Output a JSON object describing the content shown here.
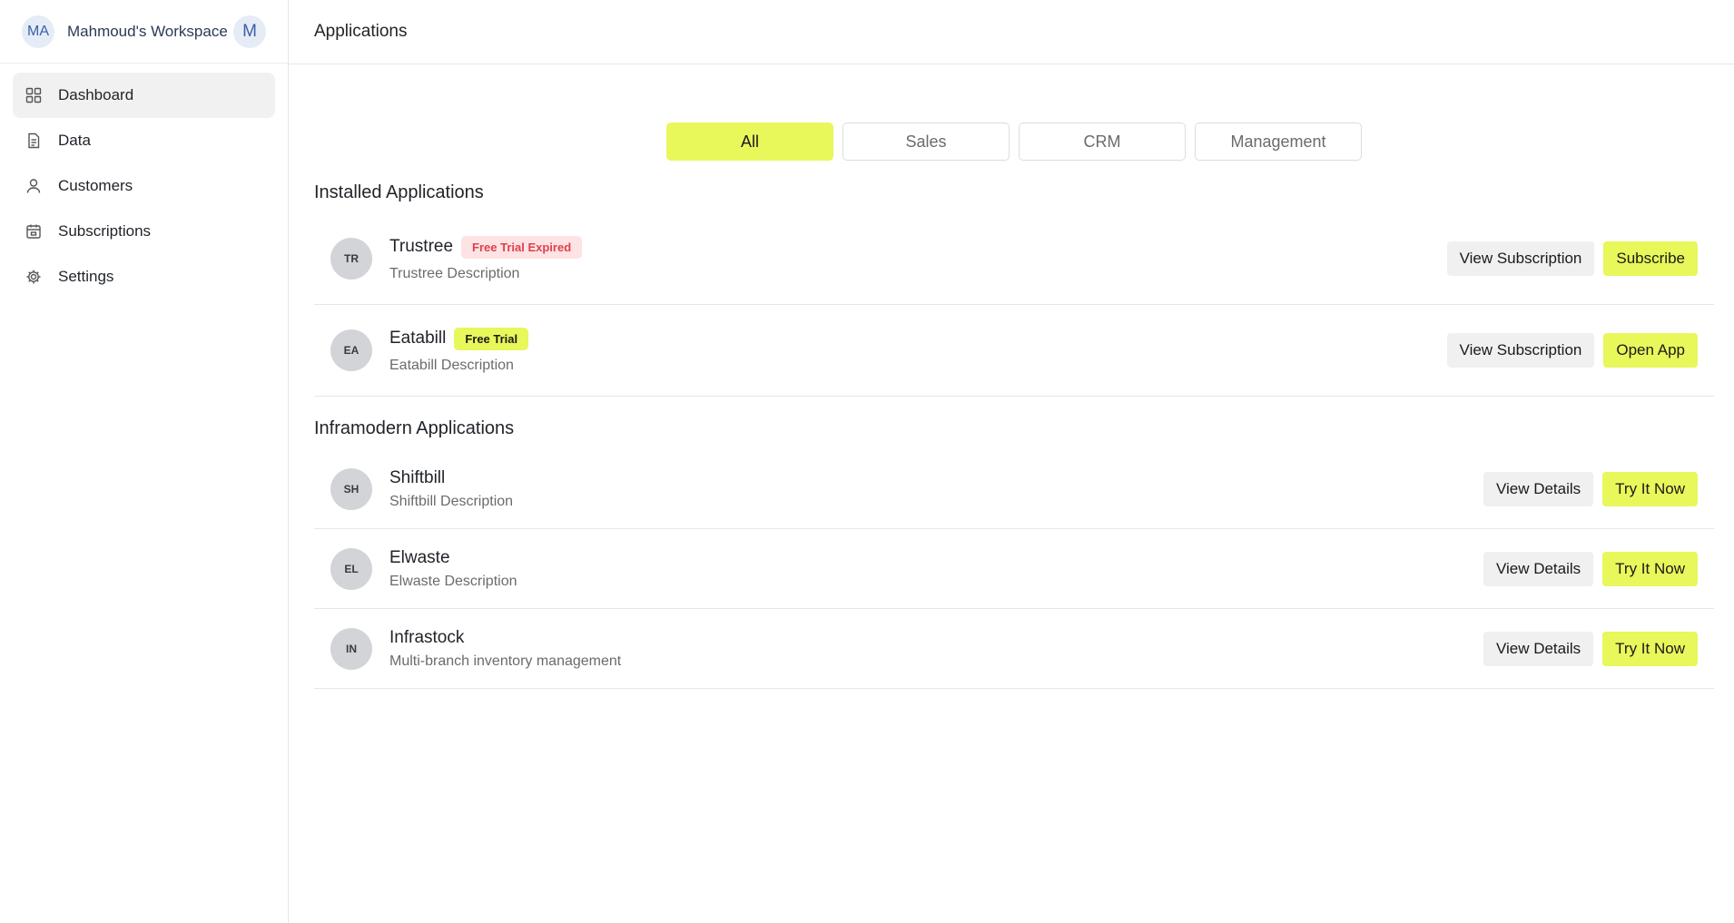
{
  "workspace": {
    "initials": "MA",
    "name": "Mahmoud's Workspace",
    "user_initial": "M"
  },
  "sidebar": {
    "items": [
      {
        "label": "Dashboard",
        "icon": "grid-icon",
        "active": true
      },
      {
        "label": "Data",
        "icon": "document-icon"
      },
      {
        "label": "Customers",
        "icon": "user-icon"
      },
      {
        "label": "Subscriptions",
        "icon": "calendar-box-icon"
      },
      {
        "label": "Settings",
        "icon": "gear-icon"
      }
    ]
  },
  "header": {
    "title": "Applications"
  },
  "filters": {
    "tabs": [
      "All",
      "Sales",
      "CRM",
      "Management"
    ],
    "active": "All"
  },
  "installed": {
    "title": "Installed Applications",
    "apps": [
      {
        "initials": "TR",
        "name": "Trustree",
        "badge": "Free Trial Expired",
        "badge_type": "expired",
        "description": "Trustree Description",
        "secondary_action": "View Subscription",
        "primary_action": "Subscribe"
      },
      {
        "initials": "EA",
        "name": "Eatabill",
        "badge": "Free Trial",
        "badge_type": "trial",
        "description": "Eatabill Description",
        "secondary_action": "View Subscription",
        "primary_action": "Open App"
      }
    ]
  },
  "inframodern": {
    "title": "Inframodern Applications",
    "apps": [
      {
        "initials": "SH",
        "name": "Shiftbill",
        "description": "Shiftbill Description",
        "secondary_action": "View Details",
        "primary_action": "Try It Now"
      },
      {
        "initials": "EL",
        "name": "Elwaste",
        "description": "Elwaste Description",
        "secondary_action": "View Details",
        "primary_action": "Try It Now"
      },
      {
        "initials": "IN",
        "name": "Infrastock",
        "description": "Multi-branch inventory management",
        "secondary_action": "View Details",
        "primary_action": "Try It Now"
      }
    ]
  },
  "colors": {
    "accent": "#e8f75a",
    "expired_bg": "#fde3e4",
    "expired_text": "#e0404d"
  }
}
